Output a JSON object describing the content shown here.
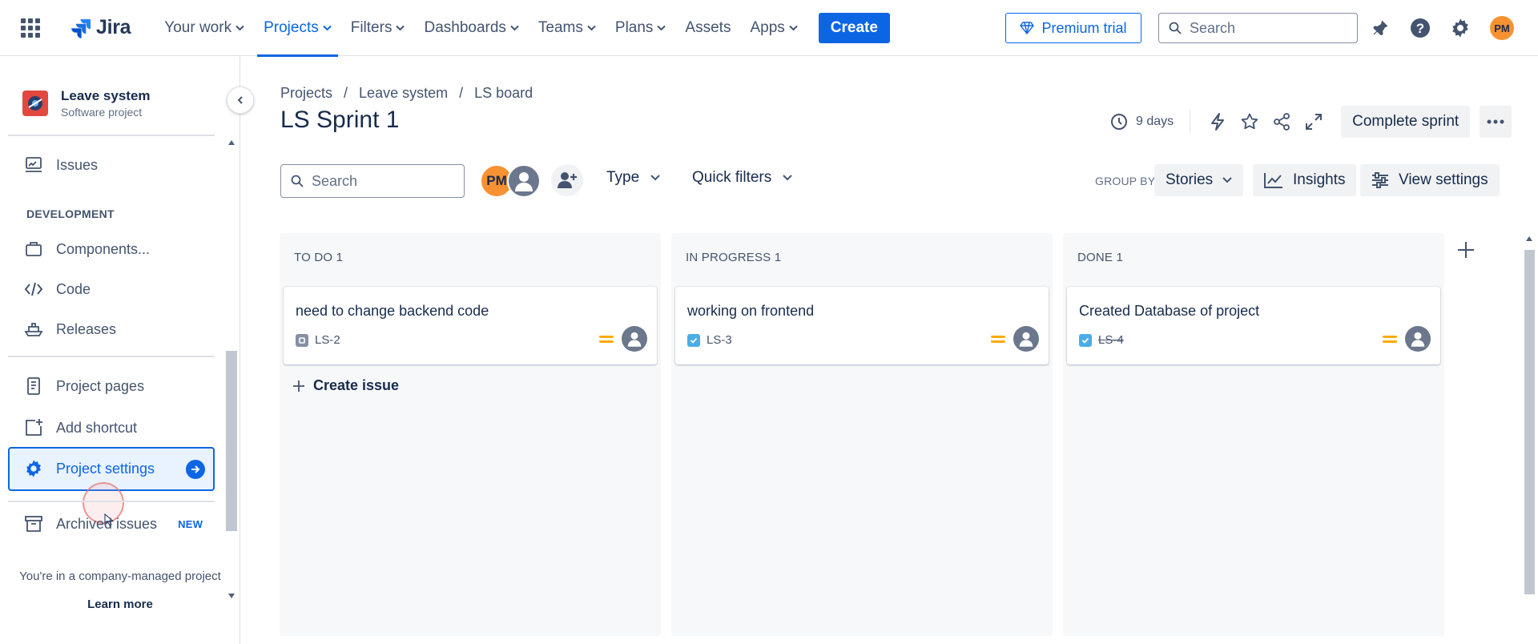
{
  "topnav": {
    "logo_text": "Jira",
    "items": [
      {
        "label": "Your work",
        "dropdown": true
      },
      {
        "label": "Projects",
        "dropdown": true,
        "active": true
      },
      {
        "label": "Filters",
        "dropdown": true
      },
      {
        "label": "Dashboards",
        "dropdown": true
      },
      {
        "label": "Teams",
        "dropdown": true
      },
      {
        "label": "Plans",
        "dropdown": true
      },
      {
        "label": "Assets",
        "dropdown": false
      },
      {
        "label": "Apps",
        "dropdown": true
      }
    ],
    "create_label": "Create",
    "premium_label": "Premium trial",
    "search_placeholder": "Search",
    "avatar_initials": "PM",
    "icons": [
      "app-switcher-icon",
      "notifications-icon",
      "help-icon",
      "settings-icon"
    ]
  },
  "sidebar": {
    "project_name": "Leave system",
    "project_type": "Software project",
    "items": {
      "issues": "Issues",
      "development_heading": "DEVELOPMENT",
      "components": "Components...",
      "code": "Code",
      "releases": "Releases",
      "project_pages": "Project pages",
      "add_shortcut": "Add shortcut",
      "project_settings": "Project settings",
      "archived_issues": "Archived issues",
      "archived_badge": "NEW"
    },
    "footer_note": "You're in a company-managed project",
    "learn_more": "Learn more"
  },
  "header": {
    "breadcrumb": [
      "Projects",
      "Leave system",
      "LS board"
    ],
    "breadcrumb_sep": "/",
    "title": "LS Sprint 1",
    "days_remaining": "9 days",
    "complete_sprint": "Complete sprint"
  },
  "filters": {
    "search_placeholder": "Search",
    "avatar_initials": "PM",
    "type_label": "Type",
    "quick_filters_label": "Quick filters",
    "group_by_label": "GROUP BY",
    "group_by_value": "Stories",
    "insights_label": "Insights",
    "view_settings_label": "View settings"
  },
  "columns": [
    {
      "title": "TO DO 1",
      "card": {
        "title": "need to change backend code",
        "key": "LS-2",
        "type": "subtask",
        "done": false
      },
      "create_issue": "Create issue"
    },
    {
      "title": "IN PROGRESS 1",
      "card": {
        "title": "working on frontend",
        "key": "LS-3",
        "type": "task",
        "done": false
      }
    },
    {
      "title": "DONE 1",
      "card": {
        "title": "Created Database of project",
        "key": "LS-4",
        "type": "task",
        "done": true
      }
    }
  ],
  "colors": {
    "brand": "#0c66e4",
    "priority_medium": "#ffab00",
    "avatar_pm": "#f79232"
  }
}
